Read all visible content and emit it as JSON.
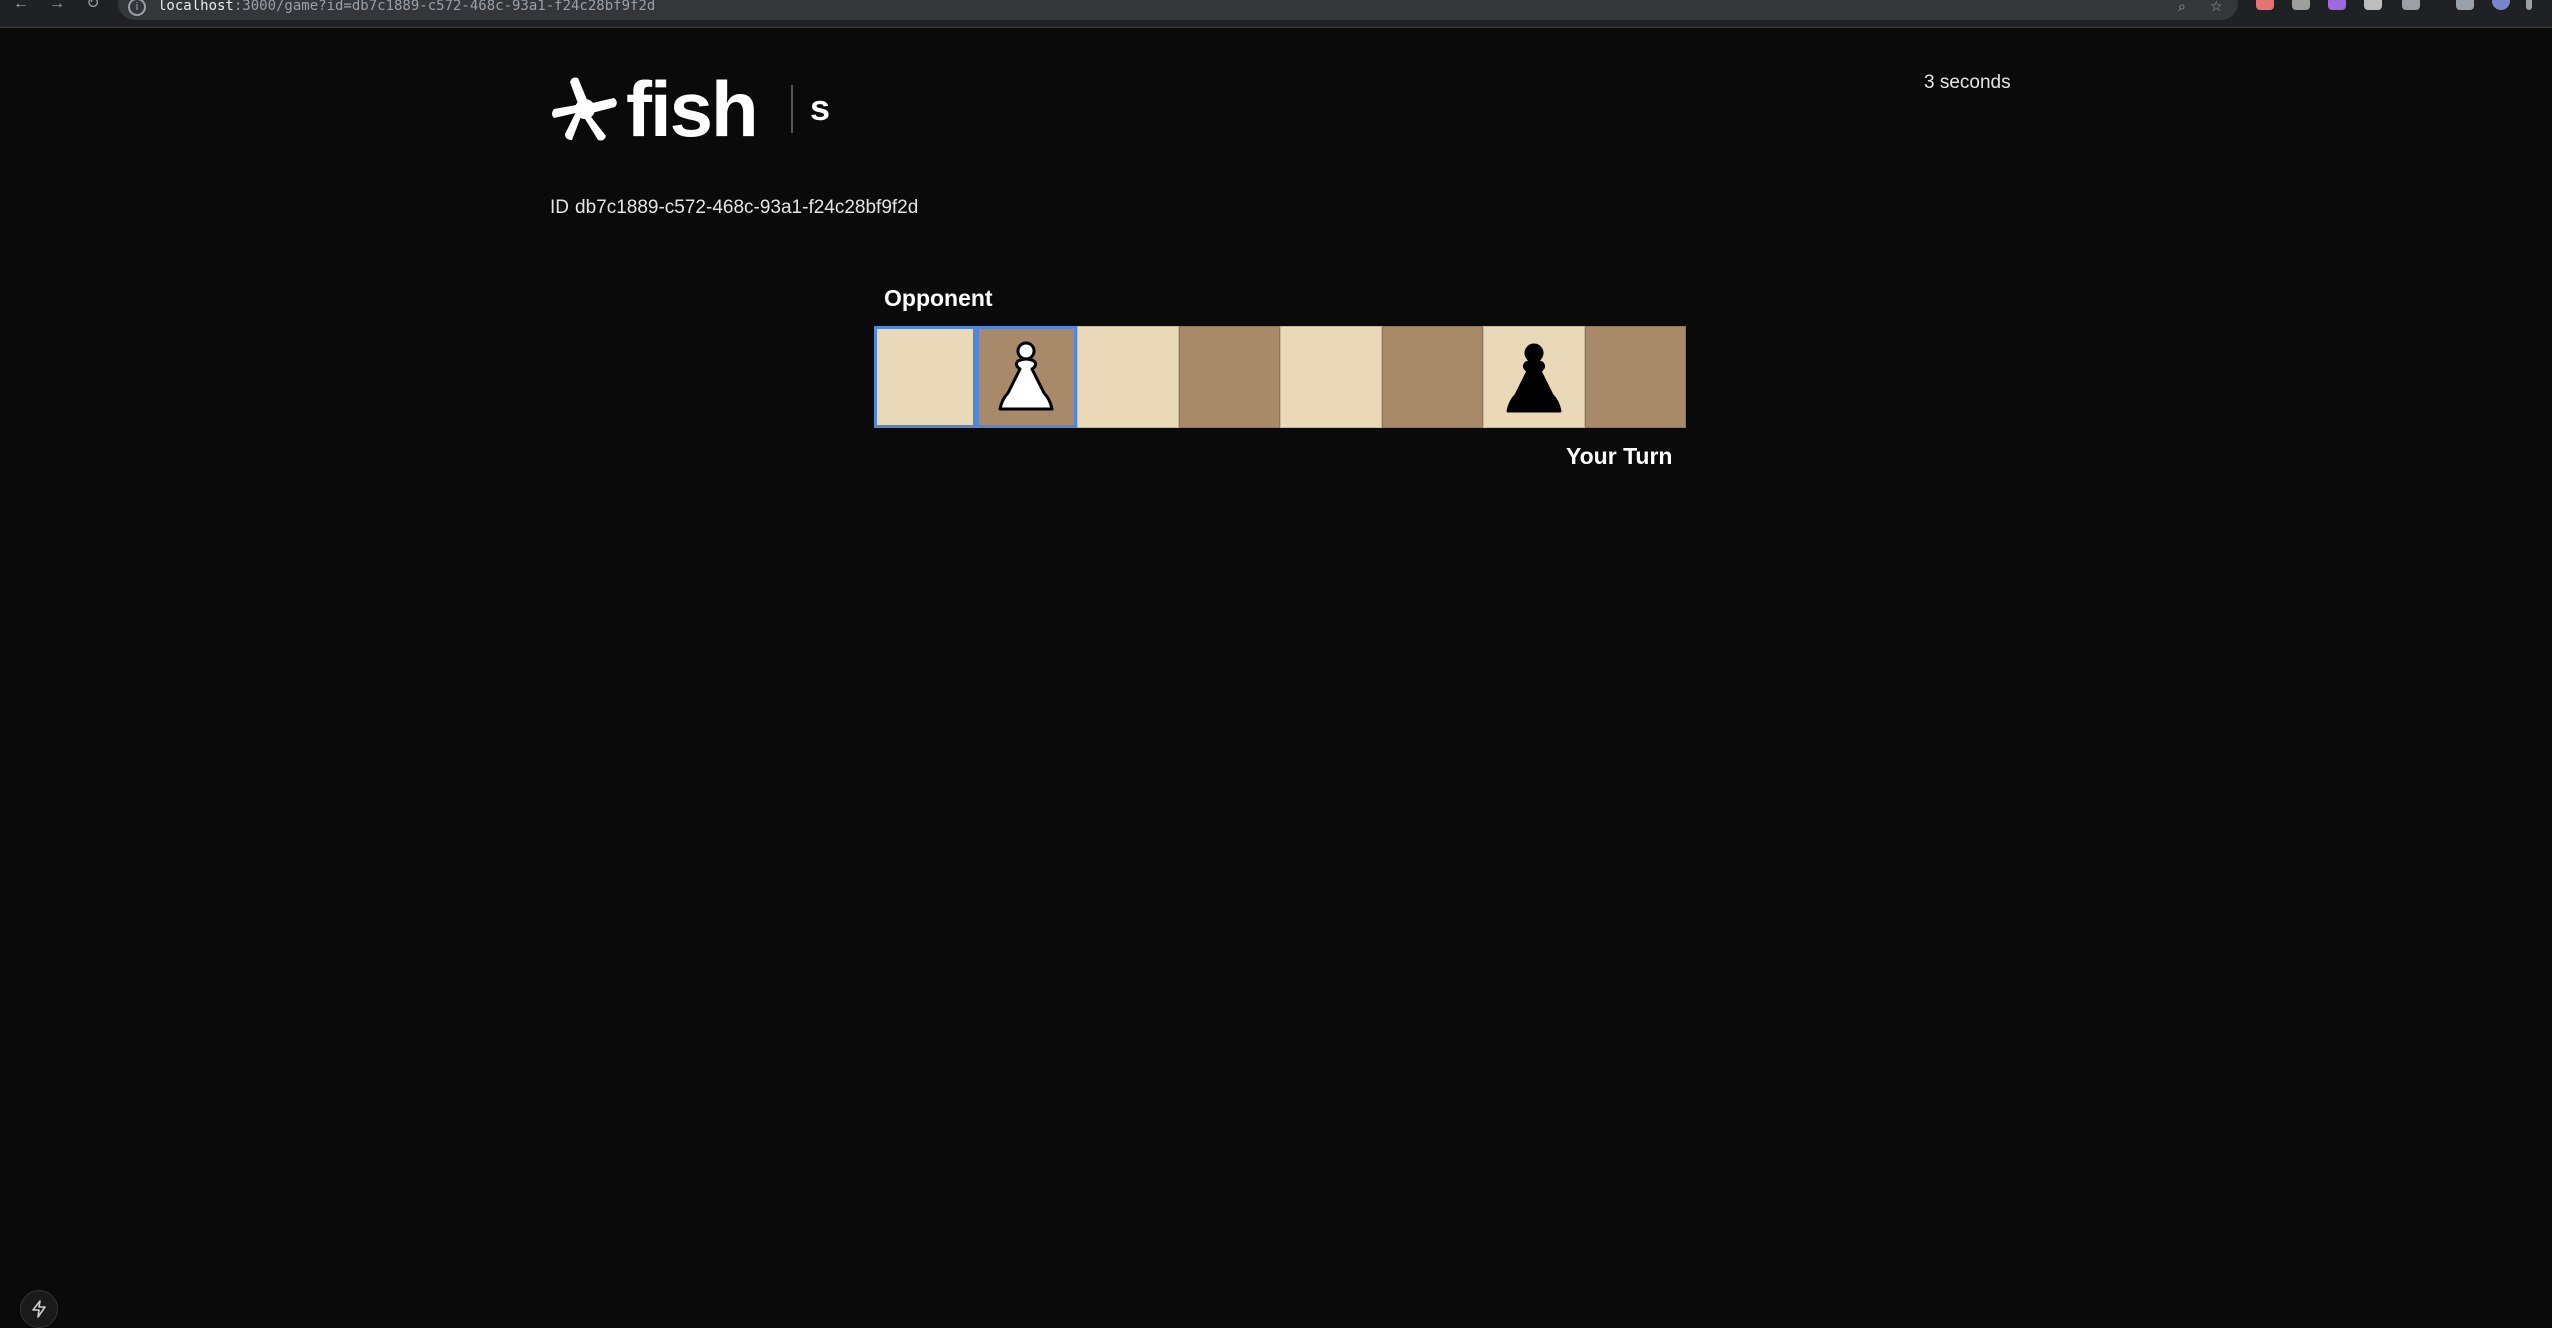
{
  "browser": {
    "url_host": "localhost",
    "url_path": ":3000/game?id=db7c1889-c572-468c-93a1-f24c28bf9f2d"
  },
  "header": {
    "logo_text": "fish",
    "subtitle": "s",
    "timer": "3 seconds"
  },
  "game": {
    "id_label": "ID",
    "id_value": "db7c1889-c572-468c-93a1-f24c28bf9f2d",
    "opponent_label": "Opponent",
    "turn_label": "Your Turn",
    "squares": [
      {
        "color": "light",
        "piece": "",
        "selected": true
      },
      {
        "color": "dark",
        "piece": "white-pawn",
        "selected": true
      },
      {
        "color": "light",
        "piece": "",
        "selected": false
      },
      {
        "color": "dark",
        "piece": "",
        "selected": false
      },
      {
        "color": "light",
        "piece": "",
        "selected": false
      },
      {
        "color": "dark",
        "piece": "",
        "selected": false
      },
      {
        "color": "light",
        "piece": "black-pawn",
        "selected": false
      },
      {
        "color": "dark",
        "piece": "",
        "selected": false
      }
    ]
  },
  "colors": {
    "background": "#0a0a0a",
    "light_square": "#ead9b8",
    "dark_square": "#a88a6a",
    "selection": "#4f88d9"
  },
  "icons": {
    "logo": "asterisk-icon",
    "dev_tools": "lightning-icon"
  }
}
